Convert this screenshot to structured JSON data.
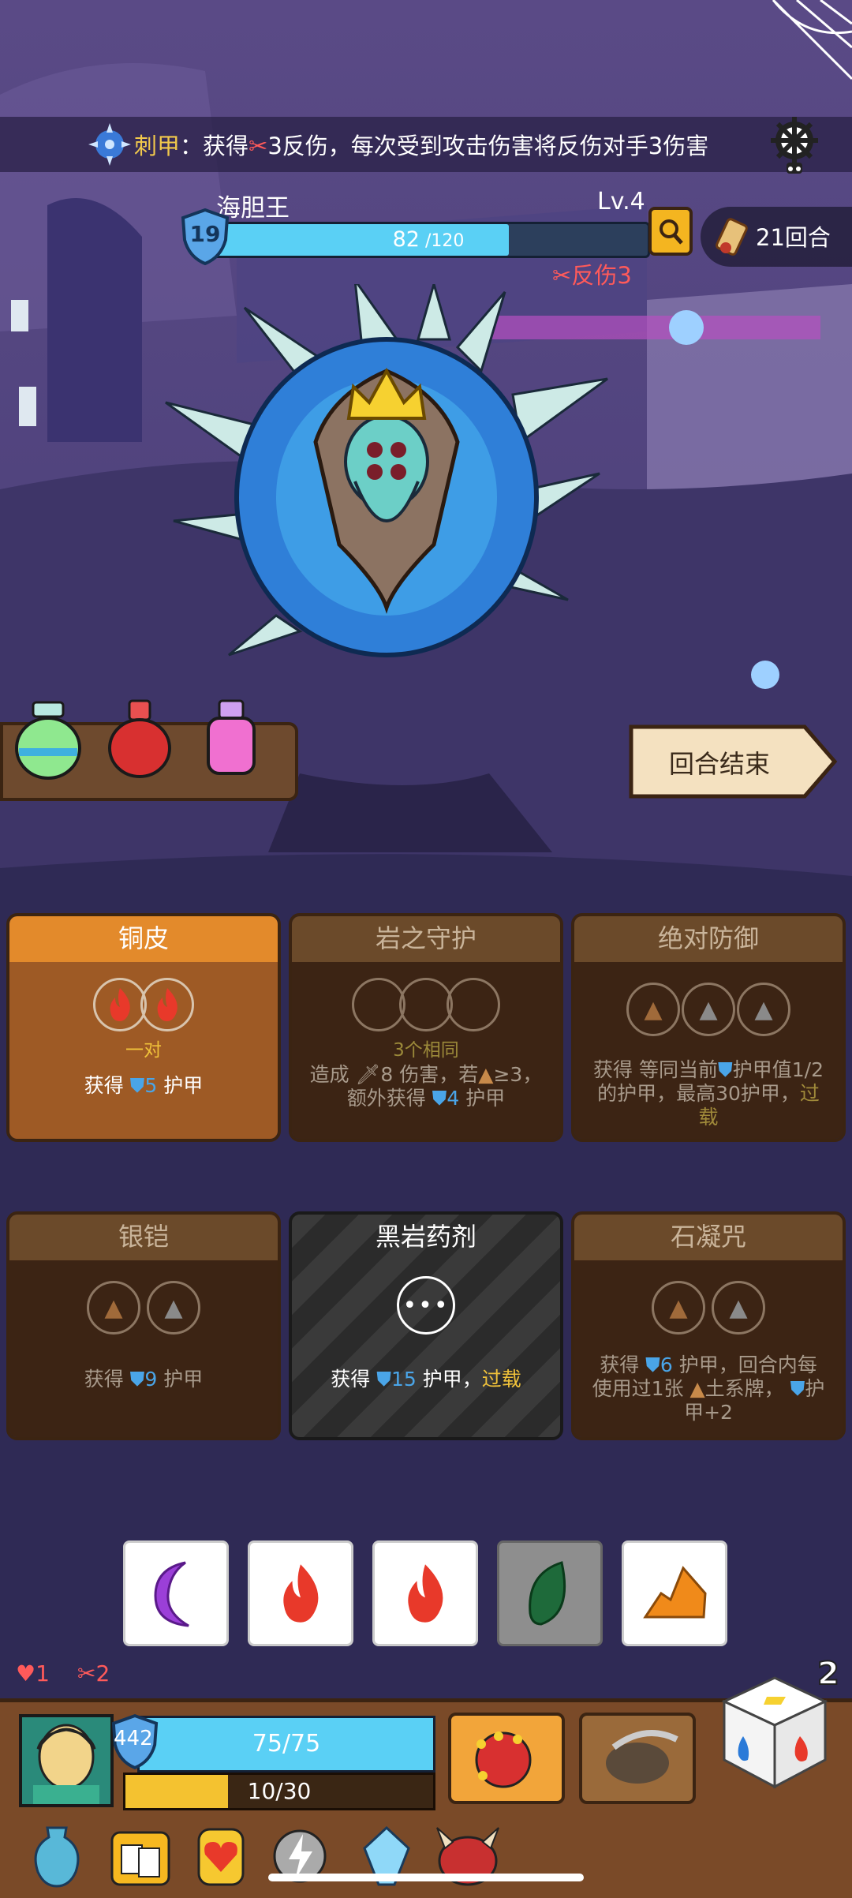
{
  "status_bar": {
    "effect_name": "刺甲",
    "effect_text_1": "：获得",
    "effect_text_2": "3反伤，每次受到攻击伤害将反伤对手3伤害"
  },
  "enemy": {
    "name": "海胆王",
    "level": "Lv.4",
    "shield": "19",
    "hp_current": "82",
    "hp_max": " /120",
    "hp_fraction": 0.683,
    "reflect_label": "反伤3"
  },
  "turn_counter": "21回合",
  "end_turn_label": "回合结束",
  "cards": [
    {
      "title": "铜皮",
      "sublabel": "一对",
      "desc_a": "获得",
      "desc_num": "5",
      "desc_b": "护甲",
      "state": "active"
    },
    {
      "title": "岩之守护",
      "sublabel": "3个相同",
      "line1": "造成",
      "line1_num": "8",
      "line1_b": "伤害，若",
      "line1_c": "≥3，",
      "line2_a": "额外获得",
      "line2_num": "4",
      "line2_b": "护甲",
      "state": "dim"
    },
    {
      "title": "绝对防御",
      "line1": "获得 等同当前",
      "line1_b": "护甲值1/2",
      "line2": "的护甲，最高30护甲，",
      "line2_gold": "过",
      "line3_gold": "载",
      "state": "dim"
    },
    {
      "title": "银铠",
      "desc_a": "获得",
      "desc_num": "9",
      "desc_b": "护甲",
      "state": "dim"
    },
    {
      "title": "黑岩药剂",
      "desc_a": "获得",
      "desc_num": "15",
      "desc_b": "护甲，",
      "desc_gold": "过载",
      "state": "stripe"
    },
    {
      "title": "石凝咒",
      "line1_a": "获得",
      "line1_num": "6",
      "line1_b": "护甲，回合内每",
      "line2_a": "使用过1张",
      "line2_b": "土系牌，",
      "line2_c": "护",
      "line3": "甲+2",
      "state": "dim"
    }
  ],
  "dice_row": [
    "moon",
    "fire",
    "fire",
    "leaf",
    "earth"
  ],
  "player": {
    "armor": "442",
    "hp": "75/75",
    "hp_fraction": 1.0,
    "energy": "10/30",
    "energy_fraction": 0.333,
    "stat_shield": "1",
    "stat_reflect": "2",
    "dice_count": "2"
  },
  "colors": {
    "hp_bar": "#5ad0f5",
    "energy_bar": "#f4c230",
    "card_active": "#e38a2b",
    "overload": "#f0c23a",
    "reflect": "#ff5a5a"
  }
}
